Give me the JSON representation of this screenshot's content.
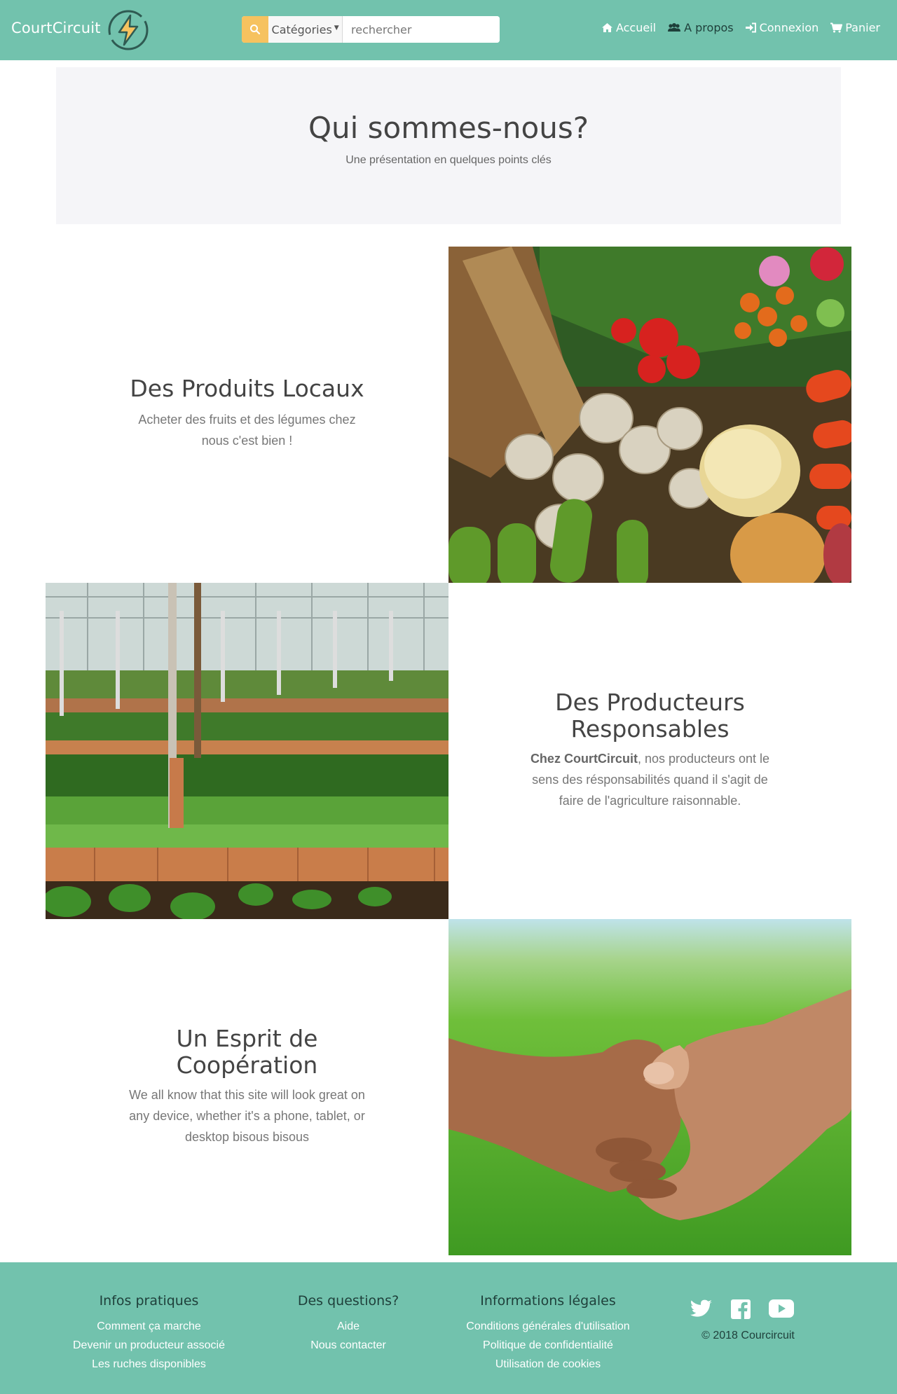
{
  "brand": {
    "name": "CourtCircuit"
  },
  "navbar": {
    "categories_label": "Catégories",
    "search_placeholder": "rechercher",
    "links": [
      {
        "label": "Accueil",
        "icon": "home-icon"
      },
      {
        "label": "A propos",
        "icon": "users-icon"
      },
      {
        "label": "Connexion",
        "icon": "sign-in-icon"
      },
      {
        "label": "Panier",
        "icon": "cart-icon"
      }
    ]
  },
  "jumbotron": {
    "title": "Qui sommes-nous?",
    "subtitle": "Une présentation en quelques points clés"
  },
  "features": [
    {
      "title": "Des Produits Locaux",
      "text": "Acheter des fruits et des légumes chez nous c'est bien !"
    },
    {
      "title_line1": "Des Producteurs",
      "title_line2": "Responsables",
      "text_bold": "Chez CourtCircuit",
      "text_rest": ", nos producteurs ont le sens des résponsabilités quand il s'agit de faire de l'agriculture raisonnable."
    },
    {
      "title_line1": "Un Esprit de",
      "title_line2": "Coopération",
      "text": "We all know that this site will look great on any device, whether it's a phone, tablet, or desktop bisous bisous"
    }
  ],
  "footer": {
    "columns": [
      {
        "heading": "Infos pratiques",
        "links": [
          "Comment ça marche",
          "Devenir un producteur associé",
          "Les ruches disponibles"
        ]
      },
      {
        "heading": "Des questions?",
        "links": [
          "Aide",
          "Nous contacter"
        ]
      },
      {
        "heading": "Informations légales",
        "links": [
          "Conditions générales d'utilisation",
          "Politique de confidentialité",
          "Utilisation de cookies"
        ]
      }
    ],
    "social_icons": [
      "twitter-icon",
      "facebook-icon",
      "youtube-icon"
    ],
    "copyright": "© 2018 Courcircuit"
  },
  "colors": {
    "primary": "#72c2ad",
    "search_button": "#f6c25f",
    "jumbotron_bg": "#f5f5f8",
    "footer_heading": "#1e3f3a"
  }
}
